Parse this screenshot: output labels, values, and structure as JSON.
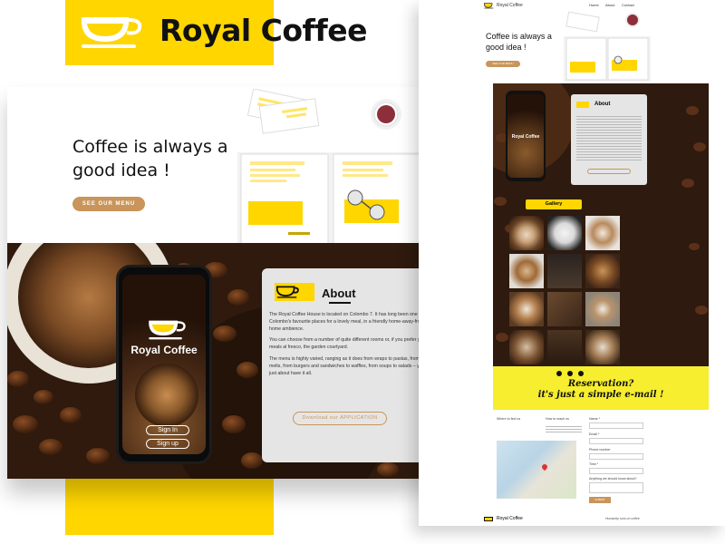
{
  "brand": {
    "name": "Royal Coffee"
  },
  "hero": {
    "headline": "Coffee is always a good idea !",
    "menu_button": "SEE OUR MENU"
  },
  "phone": {
    "app_name": "Royal Coffee",
    "sign_in": "Sign In",
    "sign_up": "Sign up"
  },
  "about": {
    "title": "About",
    "paragraphs": [
      "The Royal Coffee House is located on Colombo 7. It has long been one of Colombo's favourite places for a lovely meal, in a friendly home-away-from-home ambience.",
      "You can choose from a number of quite different rooms or, if you prefer your meals al fresco, the garden courtyard.",
      "The menu is highly varied, ranging as it does from wraps to pastas, from rottis to melts, from burgers and sandwiches to waffles, from soups to salads – you can just about have it all."
    ],
    "app_button": "Download our APPLICATION"
  },
  "right_page": {
    "nav_brand": "Royal Coffee",
    "nav_links": [
      "Home",
      "About",
      "Contact"
    ],
    "headline": "Coffee is always a good idea !",
    "menu_button": "SEE OUR MENU",
    "phone_name": "Royal Coffee",
    "about_title": "About",
    "gallery_label": "Gallery",
    "reservation_line1": "Reservation?",
    "reservation_line2": "it's just a simple e-mail !",
    "find_us": "Where to find us",
    "reach_us": "How to reach us",
    "form_labels": [
      "Name *",
      "Email *",
      "Phone number",
      "Time *",
      "Anything we should know about?"
    ],
    "submit": "SUBMIT",
    "footer_brand": "Royal Coffee",
    "footer_text": "Humanity runs on coffee"
  },
  "colors": {
    "accent_yellow": "#ffd600",
    "button_tan": "#c9955a",
    "dark_coffee": "#2b170c",
    "card_grey": "#e5e5e5"
  }
}
